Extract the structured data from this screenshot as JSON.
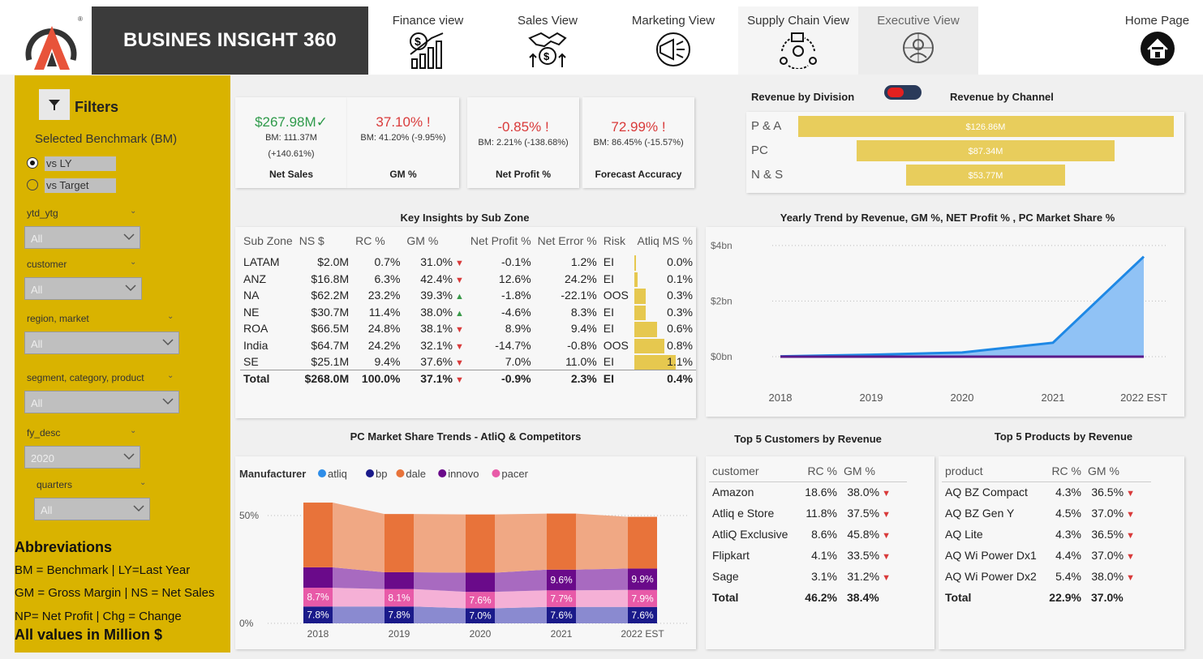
{
  "header": {
    "title": "BUSINES INSIGHT 360"
  },
  "nav": [
    {
      "label": "Finance view",
      "icon": "finance-icon"
    },
    {
      "label": "Sales View",
      "icon": "sales-icon"
    },
    {
      "label": "Marketing View",
      "icon": "marketing-icon"
    },
    {
      "label": "Supply Chain View",
      "icon": "supply-chain-icon"
    },
    {
      "label": "Executive View",
      "icon": "executive-icon"
    },
    {
      "label": "Home Page",
      "icon": "home-icon"
    }
  ],
  "filters": {
    "title": "Filters",
    "benchmark_label": "Selected Benchmark (BM)",
    "options": [
      "vs LY",
      "vs Target"
    ],
    "selected": "vs LY",
    "slicers": [
      {
        "label": "ytd_ytg",
        "value": "All"
      },
      {
        "label": "customer",
        "value": "All"
      },
      {
        "label": "region, market",
        "value": "All"
      },
      {
        "label": "segment, category, product",
        "value": "All"
      },
      {
        "label": "fy_desc",
        "value": "2020"
      },
      {
        "label": "quarters",
        "value": "All"
      }
    ]
  },
  "abbreviations": {
    "title": "Abbreviations",
    "lines": [
      "BM = Benchmark | LY=Last Year",
      "GM = Gross Margin | NS = Net Sales",
      "NP= Net Profit | Chg = Change"
    ],
    "footer": "All values in Million $"
  },
  "kpis": [
    {
      "value": "$267.98M",
      "mark": "✓",
      "bm": "BM: 111.37M",
      "chg": "(+140.61%)",
      "name": "Net Sales",
      "color": "#2e9a4a"
    },
    {
      "value": "37.10%",
      "mark": "!",
      "bm": "BM: 41.20% (-9.95%)",
      "chg": "",
      "name": "GM %",
      "color": "#d93a3a"
    },
    {
      "value": "-0.85%",
      "mark": "!",
      "bm": "BM: 2.21% (-138.68%)",
      "chg": "",
      "name": "Net Profit %",
      "color": "#d93a3a"
    },
    {
      "value": "72.99%",
      "mark": "!",
      "bm": "BM: 86.45% (-15.57%)",
      "chg": "",
      "name": "Forecast Accuracy",
      "color": "#d93a3a"
    }
  ],
  "division": {
    "title_left": "Revenue by Division",
    "title_right": "Revenue by Channel",
    "rows": [
      {
        "name": "P & A",
        "label": "$126.86M",
        "value": 126.86
      },
      {
        "name": "PC",
        "label": "$87.34M",
        "value": 87.34
      },
      {
        "name": "N & S",
        "label": "$53.77M",
        "value": 53.77
      }
    ]
  },
  "key_insights": {
    "title": "Key Insights by Sub Zone",
    "headers": [
      "Sub Zone",
      "NS $",
      "RC %",
      "GM %",
      "Net Profit %",
      "Net Error %",
      "Risk",
      "Atliq MS %"
    ],
    "rows": [
      {
        "zone": "LATAM",
        "ns": "$2.0M",
        "rc": "0.7%",
        "gm": "31.0%",
        "trend": "down",
        "np": "-0.1%",
        "ne": "1.2%",
        "risk": "EI",
        "ms": "0.0%",
        "msv": 0.0
      },
      {
        "zone": "ANZ",
        "ns": "$16.8M",
        "rc": "6.3%",
        "gm": "42.4%",
        "trend": "down",
        "np": "12.6%",
        "ne": "24.2%",
        "risk": "EI",
        "ms": "0.1%",
        "msv": 0.1
      },
      {
        "zone": "NA",
        "ns": "$62.2M",
        "rc": "23.2%",
        "gm": "39.3%",
        "trend": "up",
        "np": "-1.8%",
        "ne": "-22.1%",
        "risk": "OOS",
        "ms": "0.3%",
        "msv": 0.3
      },
      {
        "zone": "NE",
        "ns": "$30.7M",
        "rc": "11.4%",
        "gm": "38.0%",
        "trend": "up",
        "np": "-4.6%",
        "ne": "8.3%",
        "risk": "EI",
        "ms": "0.3%",
        "msv": 0.3
      },
      {
        "zone": "ROA",
        "ns": "$66.5M",
        "rc": "24.8%",
        "gm": "38.1%",
        "trend": "down",
        "np": "8.9%",
        "ne": "9.4%",
        "risk": "EI",
        "ms": "0.6%",
        "msv": 0.6
      },
      {
        "zone": "India",
        "ns": "$64.7M",
        "rc": "24.2%",
        "gm": "32.1%",
        "trend": "down",
        "np": "-14.7%",
        "ne": "-0.8%",
        "risk": "OOS",
        "ms": "0.8%",
        "msv": 0.8
      },
      {
        "zone": "SE",
        "ns": "$25.1M",
        "rc": "9.4%",
        "gm": "37.6%",
        "trend": "down",
        "np": "7.0%",
        "ne": "11.0%",
        "risk": "EI",
        "ms": "1.1%",
        "msv": 1.1
      }
    ],
    "total": {
      "zone": "Total",
      "ns": "$268.0M",
      "rc": "100.0%",
      "gm": "37.1%",
      "trend": "down",
      "np": "-0.9%",
      "ne": "2.3%",
      "risk": "EI",
      "ms": "0.4%"
    }
  },
  "yearly": {
    "title": "Yearly Trend by Revenue, GM %, NET Profit % , PC Market Share %"
  },
  "market_share": {
    "title": "PC Market Share Trends - AtliQ & Competitors",
    "legend_title": "Manufacturer"
  },
  "top_customers": {
    "title": "Top 5 Customers by Revenue",
    "headers": [
      "customer",
      "RC %",
      "GM %"
    ],
    "rows": [
      [
        "Amazon",
        "18.6%",
        "38.0%"
      ],
      [
        "Atliq e Store",
        "11.8%",
        "37.5%"
      ],
      [
        "AtliQ Exclusive",
        "8.6%",
        "45.8%"
      ],
      [
        "Flipkart",
        "4.1%",
        "33.5%"
      ],
      [
        "Sage",
        "3.1%",
        "31.2%"
      ]
    ],
    "total": [
      "Total",
      "46.2%",
      "38.4%"
    ]
  },
  "top_products": {
    "title": "Top 5 Products by Revenue",
    "headers": [
      "product",
      "RC %",
      "GM %"
    ],
    "rows": [
      [
        "AQ BZ Compact",
        "4.3%",
        "36.5%"
      ],
      [
        "AQ BZ Gen Y",
        "4.5%",
        "37.0%"
      ],
      [
        "AQ Lite",
        "4.3%",
        "36.5%"
      ],
      [
        "AQ Wi Power Dx1",
        "4.4%",
        "37.0%"
      ],
      [
        "AQ Wi Power Dx2",
        "5.4%",
        "38.0%"
      ]
    ],
    "total": [
      "Total",
      "22.9%",
      "37.0%"
    ]
  },
  "chart_data": [
    {
      "type": "area",
      "x": [
        "2018",
        "2019",
        "2020",
        "2021",
        "2022 EST"
      ],
      "series": [
        {
          "values": [
            0.01,
            0.07,
            0.15,
            0.5,
            3.6
          ]
        },
        {
          "values": [
            0,
            0,
            0,
            0,
            0
          ]
        }
      ],
      "yticks": [
        "$0bn",
        "$2bn",
        "$4bn"
      ],
      "ylim": [
        0,
        4.2
      ],
      "colors": [
        "#1e88e5",
        "#5a1a8a"
      ]
    },
    {
      "type": "area",
      "x": [
        "2018",
        "2019",
        "2020",
        "2021",
        "2022 EST"
      ],
      "series": [
        {
          "name": "atliq",
          "color": "#2e8de8",
          "values": [
            0,
            0,
            0,
            0,
            0
          ]
        },
        {
          "name": "bp",
          "color": "#1a1a8a",
          "values": [
            7.8,
            7.8,
            7.0,
            7.6,
            7.6
          ]
        },
        {
          "name": "dale",
          "color": "#e8733a",
          "values": [
            30,
            27,
            27,
            26,
            24
          ]
        },
        {
          "name": "innovo",
          "color": "#6a0a8a",
          "values": [
            9.5,
            7.8,
            8.9,
            9.6,
            9.9
          ]
        },
        {
          "name": "pacer",
          "color": "#e85aa8",
          "values": [
            8.7,
            8.1,
            7.6,
            7.7,
            7.9
          ]
        }
      ],
      "labels": [
        [
          "7.8%",
          "8.7%"
        ],
        [
          "7.8%",
          "8.1%"
        ],
        [
          "7.0%",
          "7.6%"
        ],
        [
          "7.6%",
          "7.7%",
          "9.6%"
        ],
        [
          "7.6%",
          "7.9%",
          "9.9%"
        ]
      ],
      "yticks": [
        "0%",
        "50%"
      ]
    }
  ]
}
